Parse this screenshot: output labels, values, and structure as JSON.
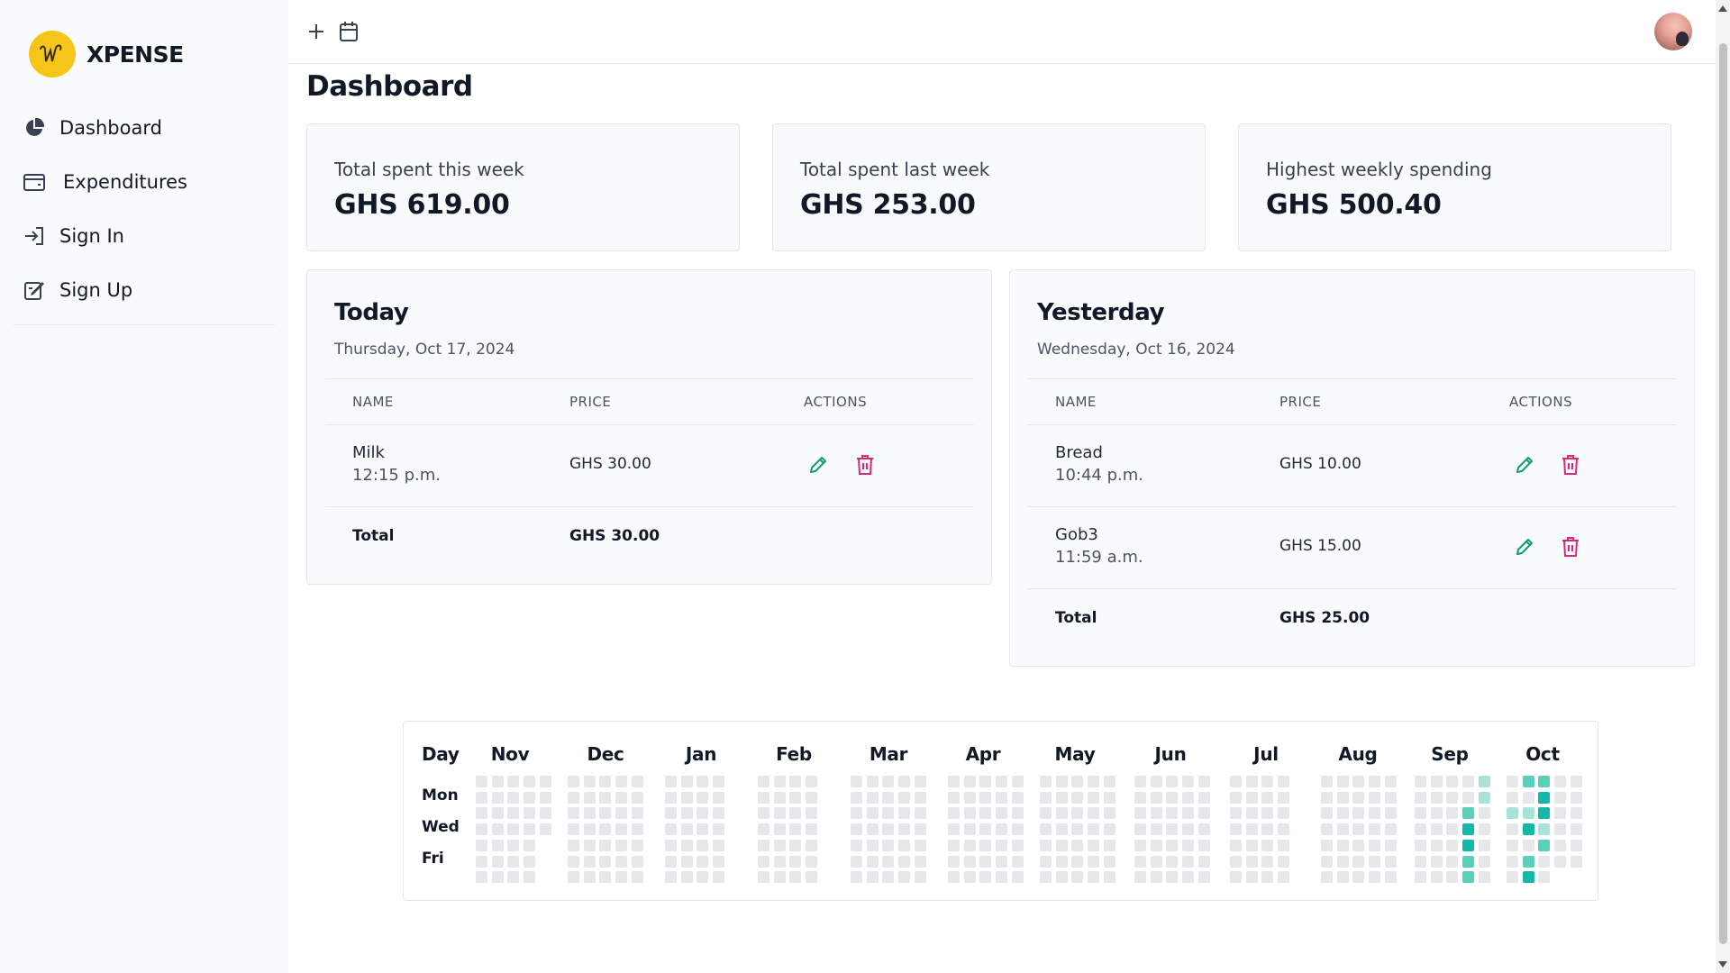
{
  "brand": {
    "name": "XPENSE",
    "logo_letter": "W"
  },
  "sidebar": {
    "items": [
      {
        "label": "Dashboard",
        "icon": "pie-chart-icon"
      },
      {
        "label": "Expenditures",
        "icon": "wallet-icon"
      },
      {
        "label": "Sign In",
        "icon": "sign-in-icon"
      },
      {
        "label": "Sign Up",
        "icon": "edit-icon"
      }
    ]
  },
  "topbar": {
    "add_icon": "plus-icon",
    "calendar_icon": "calendar-icon",
    "avatar": "user-avatar"
  },
  "page": {
    "title": "Dashboard"
  },
  "stats": [
    {
      "label": "Total spent this week",
      "value": "GHS 619.00"
    },
    {
      "label": "Total spent last week",
      "value": "GHS 253.00"
    },
    {
      "label": "Highest weekly spending",
      "value": "GHS 500.40"
    }
  ],
  "today": {
    "title": "Today",
    "date": "Thursday, Oct 17, 2024",
    "columns": [
      "NAME",
      "PRICE",
      "ACTIONS"
    ],
    "rows": [
      {
        "name": "Milk",
        "time": "12:15 p.m.",
        "price": "GHS 30.00"
      }
    ],
    "total_label": "Total",
    "total_value": "GHS 30.00"
  },
  "yesterday": {
    "title": "Yesterday",
    "date": "Wednesday, Oct 16, 2024",
    "columns": [
      "NAME",
      "PRICE",
      "ACTIONS"
    ],
    "rows": [
      {
        "name": "Bread",
        "time": "10:44 p.m.",
        "price": "GHS 10.00"
      },
      {
        "name": "Gob3",
        "time": "11:59 a.m.",
        "price": "GHS 15.00"
      }
    ],
    "total_label": "Total",
    "total_value": "GHS 25.00"
  },
  "heatmap": {
    "day_header": "Day",
    "day_labels": [
      "Mon",
      "Wed",
      "Fri"
    ],
    "months": [
      "Nov",
      "Dec",
      "Jan",
      "Feb",
      "Mar",
      "Apr",
      "May",
      "Jun",
      "Jul",
      "Aug",
      "Sep",
      "Oct"
    ],
    "colors": {
      "empty": "#e5e7eb",
      "low": "#a7e3d7",
      "mid": "#5ccfba",
      "high": "#14b8a6"
    }
  },
  "colors": {
    "edit": "#0f9d76",
    "delete": "#db2777",
    "accent": "#14b8a6",
    "logo": "#f5c518"
  }
}
